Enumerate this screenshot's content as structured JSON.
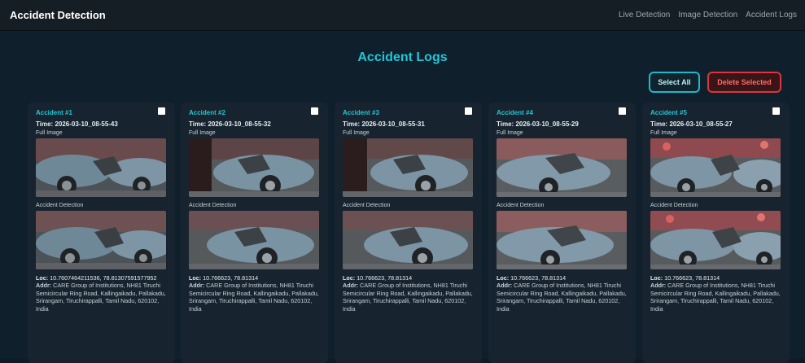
{
  "header": {
    "title": "Accident Detection",
    "nav": [
      "Live Detection",
      "Image Detection",
      "Accident Logs"
    ]
  },
  "main": {
    "title": "Accident Logs",
    "select_all": "Select All",
    "delete_selected": "Delete Selected",
    "cards": [
      {
        "title": "Accident #1",
        "time_label": "Time:",
        "time": "2026-03-10_08-55-43",
        "full_label": "Full Image",
        "det_label": "Accident Detection",
        "loc_label": "Loc:",
        "loc": "10.7607464211536, 78.81307591577952",
        "addr_label": "Addr:",
        "addr": "CARE Group of Institutions, NH81 Tiruchi Semicircular Ring Road, Kallingaikadu, Pallakadu, Srirangam, Tiruchirappalli, Tamil Nadu, 620102, India"
      },
      {
        "title": "Accident #2",
        "time_label": "Time:",
        "time": "2026-03-10_08-55-32",
        "full_label": "Full Image",
        "det_label": "Accident Detection",
        "loc_label": "Loc:",
        "loc": "10.766623, 78.81314",
        "addr_label": "Addr:",
        "addr": "CARE Group of Institutions, NH81 Tiruchi Semicircular Ring Road, Kallingaikadu, Pallakadu, Srirangam, Tiruchirappalli, Tamil Nadu, 620102, India"
      },
      {
        "title": "Accident #3",
        "time_label": "Time:",
        "time": "2026-03-10_08-55-31",
        "full_label": "Full Image",
        "det_label": "Accident Detection",
        "loc_label": "Loc:",
        "loc": "10.766623, 78.81314",
        "addr_label": "Addr:",
        "addr": "CARE Group of Institutions, NH81 Tiruchi Semicircular Ring Road, Kallingaikadu, Pallakadu, Srirangam, Tiruchirappalli, Tamil Nadu, 620102, India"
      },
      {
        "title": "Accident #4",
        "time_label": "Time:",
        "time": "2026-03-10_08-55-29",
        "full_label": "Full Image",
        "det_label": "Accident Detection",
        "loc_label": "Loc:",
        "loc": "10.766623, 78.81314",
        "addr_label": "Addr:",
        "addr": "CARE Group of Institutions, NH81 Tiruchi Semicircular Ring Road, Kallingaikadu, Pallakadu, Srirangam, Tiruchirappalli, Tamil Nadu, 620102, India"
      },
      {
        "title": "Accident #5",
        "time_label": "Time:",
        "time": "2026-03-10_08-55-27",
        "full_label": "Full Image",
        "det_label": "Accident Detection",
        "loc_label": "Loc:",
        "loc": "10.766623, 78.81314",
        "addr_label": "Addr:",
        "addr": "CARE Group of Institutions, NH81 Tiruchi Semicircular Ring Road, Kallingaikadu, Pallakadu, Srirangam, Tiruchirappalli, Tamil Nadu, 620102, India"
      }
    ]
  }
}
